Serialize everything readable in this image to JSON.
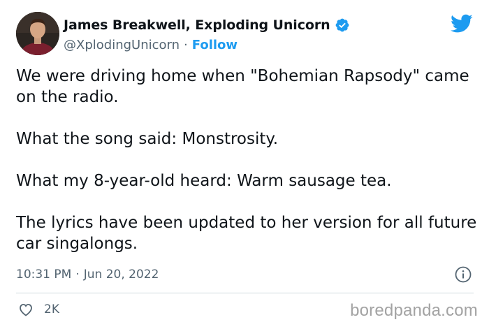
{
  "author": {
    "name": "James Breakwell, Exploding Unicorn",
    "handle": "@XplodingUnicorn",
    "separator": "·",
    "follow_label": "Follow",
    "verified_icon": "verified-badge-icon",
    "avatar_icon": "avatar"
  },
  "brand": {
    "icon": "twitter-bird-icon",
    "accent_color": "#1d9bf0"
  },
  "tweet": {
    "paragraphs": [
      "We were driving home when \"Bohemian Rapsody\" came on the radio.",
      "What the song said: Monstrosity.",
      "What my 8-year-old heard: Warm sausage tea.",
      "The lyrics have been updated to her version for all future car singalongs."
    ],
    "time": "10:31 PM",
    "separator": "·",
    "date": "Jun 20, 2022"
  },
  "engagement": {
    "likes": "2K",
    "like_icon": "heart-icon",
    "info_icon": "info-icon"
  },
  "watermark": "boredpanda.com"
}
